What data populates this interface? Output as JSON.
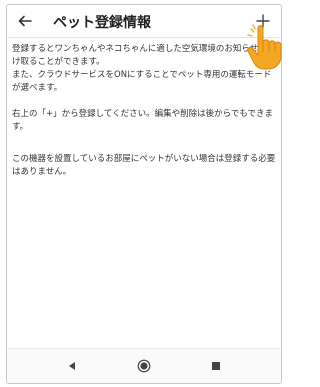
{
  "header": {
    "title": "ペット登録情報"
  },
  "content": {
    "paragraphs": [
      "登録するとワンちゃんやネコちゃんに適した空気環境のお知らせを受け取ることができます。",
      "また、クラウドサービスをONにすることでペット専用の運転モードが選べます。",
      "右上の「+」から登録してください。編集や削除は後からでもできます。",
      "この機器を設置しているお部屋にペットがいない場合は登録する必要はありません。"
    ]
  },
  "icons": {
    "back": "arrow-left-icon",
    "add": "plus-icon",
    "nav_back": "triangle-back-icon",
    "nav_home": "circle-home-icon",
    "nav_recent": "square-recent-icon",
    "pointer": "hand-pointer-icon"
  },
  "colors": {
    "hand": "#F5A623",
    "text": "#333333",
    "icon": "#444444"
  }
}
